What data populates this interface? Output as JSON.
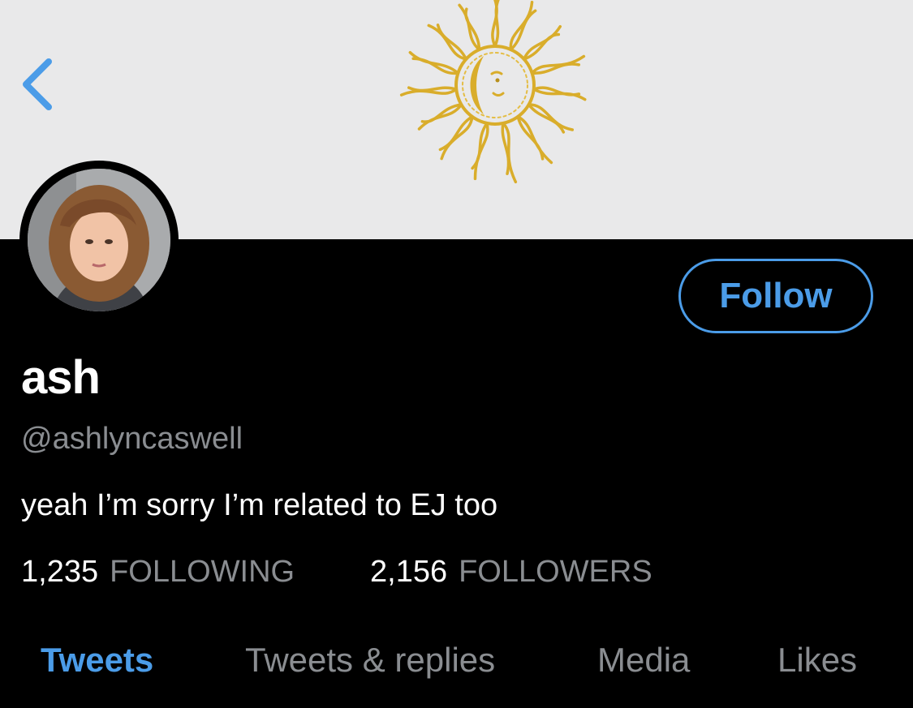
{
  "header": {
    "back_icon": "chevron-left-icon",
    "banner_image": "golden sun drawing",
    "banner_color": "#e9e9ea",
    "accent_color": "#4b9ce8"
  },
  "profile": {
    "avatar": "profile photo",
    "display_name": "ash",
    "handle": "@ashlyncaswell",
    "bio": "yeah I’m sorry I’m related to EJ too",
    "follow_label": "Follow"
  },
  "stats": {
    "following_count": "1,235",
    "following_label": "FOLLOWING",
    "followers_count": "2,156",
    "followers_label": "FOLLOWERS"
  },
  "tabs": [
    {
      "label": "Tweets",
      "active": true
    },
    {
      "label": "Tweets & replies",
      "active": false
    },
    {
      "label": "Media",
      "active": false
    },
    {
      "label": "Likes",
      "active": false
    }
  ]
}
